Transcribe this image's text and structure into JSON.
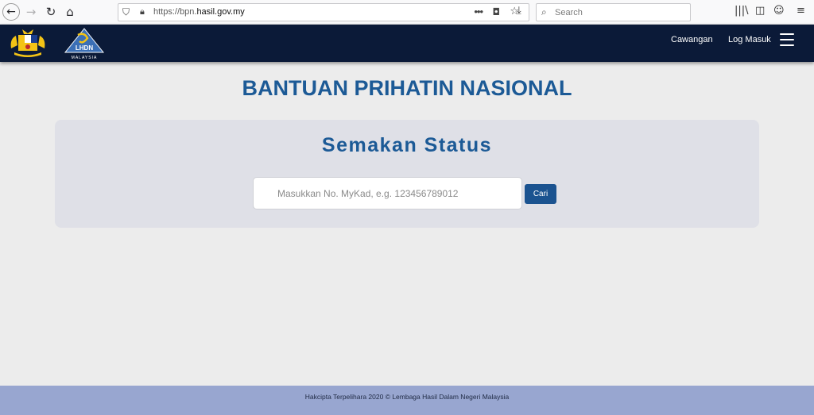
{
  "browser": {
    "url_prefix": "https://bpn.",
    "url_domain": "hasil.gov.my",
    "search_placeholder": "Search",
    "icons": [
      "back-arrow-icon",
      "forward-arrow-icon",
      "reload-icon",
      "home-icon",
      "shield-icon",
      "lock-icon",
      "more-actions-icon",
      "pocket-icon",
      "bookmark-star-icon",
      "download-icon",
      "search-icon",
      "library-icon",
      "sidebar-icon",
      "account-icon",
      "menu-icon"
    ]
  },
  "header": {
    "nav": [
      {
        "label": "Cawangan"
      },
      {
        "label": "Log Masuk"
      }
    ],
    "lhdn_logo_text": "LHDN",
    "lhdn_logo_subtext": "MALAYSIA",
    "colors": {
      "background": "#0b1a38"
    }
  },
  "main": {
    "title": "BANTUAN PRIHATIN NASIONAL",
    "card_title": "Semakan Status",
    "input_placeholder": "Masukkan No. MyKad, e.g. 123456789012",
    "button_label": "Cari",
    "colors": {
      "accent": "#1c5a96",
      "card_bg": "#dfe0e7"
    }
  },
  "footer": {
    "text": "Hakcipta Terpelihara 2020 © Lembaga Hasil Dalam Negeri Malaysia"
  }
}
